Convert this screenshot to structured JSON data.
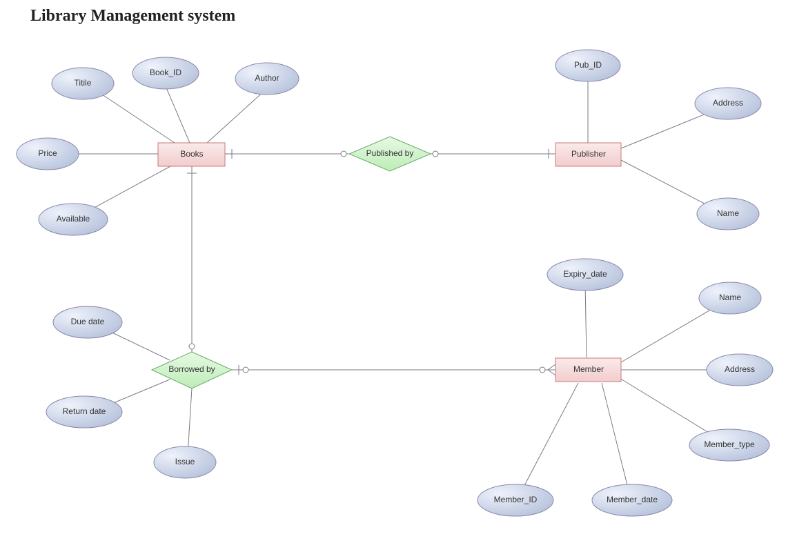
{
  "title": "Library Management system",
  "entities": {
    "books": "Books",
    "publisher": "Publisher",
    "member": "Member"
  },
  "relationships": {
    "published_by": "Published by",
    "borrowed_by": "Borrowed by"
  },
  "attributes": {
    "books": {
      "title": "Titile",
      "book_id": "Book_ID",
      "author": "Author",
      "price": "Price",
      "available": "Available"
    },
    "publisher": {
      "pub_id": "Pub_ID",
      "address": "Address",
      "name": "Name"
    },
    "member": {
      "expiry_date": "Expiry_date",
      "name": "Name",
      "address": "Address",
      "member_type": "Member_type",
      "member_date": "Member_date",
      "member_id": "Member_ID"
    },
    "borrowed_by": {
      "due_date": "Due date",
      "return_date": "Return date",
      "issue": "Issue"
    }
  }
}
